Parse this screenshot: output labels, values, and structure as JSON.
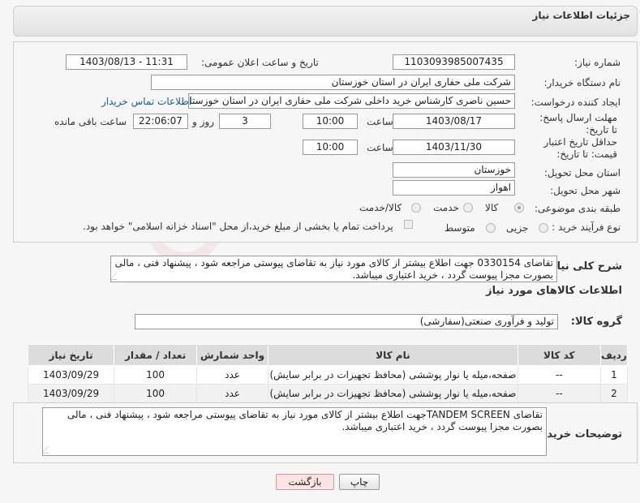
{
  "header": {
    "title": "جزئیات اطلاعات نیاز"
  },
  "watermark": "AriaTender.neT",
  "form": {
    "need_number_label": "شماره نیاز:",
    "need_number": "1103093985007435",
    "announce_label": "تاریخ و ساعت اعلان عمومی:",
    "announce_value": "1403/08/13 - 11:31",
    "buyer_label": "نام دستگاه خریدار:",
    "buyer_value": "شرکت ملی حفاری ایران در استان خوزستان",
    "creator_label": "ایجاد کننده درخواست:",
    "creator_value": "حسین ناصری کارشناس خرید داخلی شرکت ملی حفاری ایران در استان خوزستان",
    "contact_link": "اطلاعات تماس خریدار",
    "deadline_label": "مهلت ارسال پاسخ: تا تاریخ:",
    "deadline_date": "1403/08/17",
    "time_label": "ساعت",
    "deadline_time": "10:00",
    "days_value": "3",
    "days_label": "روز و",
    "remaining_time": "22:06:07",
    "remaining_label": "ساعت باقی مانده",
    "validity_label": "حداقل تاریخ اعتبار قیمت: تا تاریخ:",
    "validity_date": "1403/11/30",
    "validity_time_label": "ساعت",
    "validity_time": "10:00",
    "province_label": "استان محل تحویل:",
    "province_value": "خوزستان",
    "city_label": "شهر محل تحویل:",
    "city_value": "اهواز",
    "category_label": "طبقه بندی موضوعی:",
    "category_options": [
      "کالا",
      "خدمت",
      "کالا/خدمت"
    ],
    "process_label": "نوع فرآیند خرید :",
    "process_options": [
      "جزیی",
      "متوسط"
    ],
    "payment_note": "پرداخت تمام یا بخشی از مبلغ خرید،از محل \"اسناد خزانه اسلامی\" خواهد بود."
  },
  "description": {
    "label": "شرح کلی نیاز:",
    "text": "تقاضای 0330154 جهت اطلاع بیشتر از کالای مورد نیاز به تقاضای پیوستی مراجعه شود ، پیشنهاد فنی ، مالی بصورت مجزا پیوست گردد ، خرید اعتباری میباشد."
  },
  "goods": {
    "section_title": "اطلاعات کالاهای مورد نیاز",
    "group_label": "گروه کالا:",
    "group_value": "تولید و فرآوری صنعتی(سفارشی)",
    "columns": [
      "ردیف",
      "کد کالا",
      "نام کالا",
      "واحد شمارش",
      "تعداد / مقدار",
      "تاریخ نیاز"
    ],
    "rows": [
      {
        "row": "1",
        "code": "--",
        "name": "صفحه،میله یا نوار پوششی (محافظ تجهیزات در برابر سایش)",
        "unit": "عدد",
        "qty": "100",
        "date": "1403/09/29"
      },
      {
        "row": "2",
        "code": "--",
        "name": "صفحه،میله یا نوار پوششی (محافظ تجهیزات در برابر سایش)",
        "unit": "عدد",
        "qty": "100",
        "date": "1403/09/29"
      }
    ]
  },
  "buyer_notes": {
    "label": "توضیحات خریدار:",
    "text": "تقاضای TANDEM SCREENجهت اطلاع بیشتر از کالای مورد نیاز به تقاضای پیوستی مراجعه شود ، پیشنهاد فنی ، مالی بصورت مجزا پیوست گردد ، خرید اعتباری میباشد."
  },
  "buttons": {
    "print": "چاپ",
    "back": "بازگشت"
  }
}
